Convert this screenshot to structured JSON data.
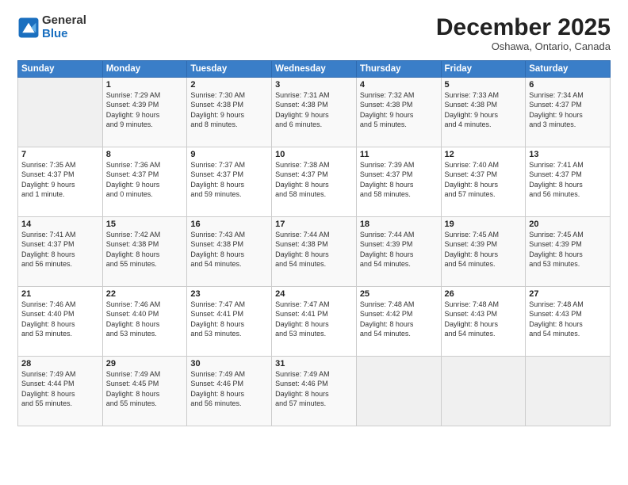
{
  "logo": {
    "general": "General",
    "blue": "Blue"
  },
  "title": "December 2025",
  "location": "Oshawa, Ontario, Canada",
  "days_header": [
    "Sunday",
    "Monday",
    "Tuesday",
    "Wednesday",
    "Thursday",
    "Friday",
    "Saturday"
  ],
  "weeks": [
    [
      {
        "num": "",
        "info": ""
      },
      {
        "num": "1",
        "info": "Sunrise: 7:29 AM\nSunset: 4:39 PM\nDaylight: 9 hours\nand 9 minutes."
      },
      {
        "num": "2",
        "info": "Sunrise: 7:30 AM\nSunset: 4:38 PM\nDaylight: 9 hours\nand 8 minutes."
      },
      {
        "num": "3",
        "info": "Sunrise: 7:31 AM\nSunset: 4:38 PM\nDaylight: 9 hours\nand 6 minutes."
      },
      {
        "num": "4",
        "info": "Sunrise: 7:32 AM\nSunset: 4:38 PM\nDaylight: 9 hours\nand 5 minutes."
      },
      {
        "num": "5",
        "info": "Sunrise: 7:33 AM\nSunset: 4:38 PM\nDaylight: 9 hours\nand 4 minutes."
      },
      {
        "num": "6",
        "info": "Sunrise: 7:34 AM\nSunset: 4:37 PM\nDaylight: 9 hours\nand 3 minutes."
      }
    ],
    [
      {
        "num": "7",
        "info": "Sunrise: 7:35 AM\nSunset: 4:37 PM\nDaylight: 9 hours\nand 1 minute."
      },
      {
        "num": "8",
        "info": "Sunrise: 7:36 AM\nSunset: 4:37 PM\nDaylight: 9 hours\nand 0 minutes."
      },
      {
        "num": "9",
        "info": "Sunrise: 7:37 AM\nSunset: 4:37 PM\nDaylight: 8 hours\nand 59 minutes."
      },
      {
        "num": "10",
        "info": "Sunrise: 7:38 AM\nSunset: 4:37 PM\nDaylight: 8 hours\nand 58 minutes."
      },
      {
        "num": "11",
        "info": "Sunrise: 7:39 AM\nSunset: 4:37 PM\nDaylight: 8 hours\nand 58 minutes."
      },
      {
        "num": "12",
        "info": "Sunrise: 7:40 AM\nSunset: 4:37 PM\nDaylight: 8 hours\nand 57 minutes."
      },
      {
        "num": "13",
        "info": "Sunrise: 7:41 AM\nSunset: 4:37 PM\nDaylight: 8 hours\nand 56 minutes."
      }
    ],
    [
      {
        "num": "14",
        "info": "Sunrise: 7:41 AM\nSunset: 4:37 PM\nDaylight: 8 hours\nand 56 minutes."
      },
      {
        "num": "15",
        "info": "Sunrise: 7:42 AM\nSunset: 4:38 PM\nDaylight: 8 hours\nand 55 minutes."
      },
      {
        "num": "16",
        "info": "Sunrise: 7:43 AM\nSunset: 4:38 PM\nDaylight: 8 hours\nand 54 minutes."
      },
      {
        "num": "17",
        "info": "Sunrise: 7:44 AM\nSunset: 4:38 PM\nDaylight: 8 hours\nand 54 minutes."
      },
      {
        "num": "18",
        "info": "Sunrise: 7:44 AM\nSunset: 4:39 PM\nDaylight: 8 hours\nand 54 minutes."
      },
      {
        "num": "19",
        "info": "Sunrise: 7:45 AM\nSunset: 4:39 PM\nDaylight: 8 hours\nand 54 minutes."
      },
      {
        "num": "20",
        "info": "Sunrise: 7:45 AM\nSunset: 4:39 PM\nDaylight: 8 hours\nand 53 minutes."
      }
    ],
    [
      {
        "num": "21",
        "info": "Sunrise: 7:46 AM\nSunset: 4:40 PM\nDaylight: 8 hours\nand 53 minutes."
      },
      {
        "num": "22",
        "info": "Sunrise: 7:46 AM\nSunset: 4:40 PM\nDaylight: 8 hours\nand 53 minutes."
      },
      {
        "num": "23",
        "info": "Sunrise: 7:47 AM\nSunset: 4:41 PM\nDaylight: 8 hours\nand 53 minutes."
      },
      {
        "num": "24",
        "info": "Sunrise: 7:47 AM\nSunset: 4:41 PM\nDaylight: 8 hours\nand 53 minutes."
      },
      {
        "num": "25",
        "info": "Sunrise: 7:48 AM\nSunset: 4:42 PM\nDaylight: 8 hours\nand 54 minutes."
      },
      {
        "num": "26",
        "info": "Sunrise: 7:48 AM\nSunset: 4:43 PM\nDaylight: 8 hours\nand 54 minutes."
      },
      {
        "num": "27",
        "info": "Sunrise: 7:48 AM\nSunset: 4:43 PM\nDaylight: 8 hours\nand 54 minutes."
      }
    ],
    [
      {
        "num": "28",
        "info": "Sunrise: 7:49 AM\nSunset: 4:44 PM\nDaylight: 8 hours\nand 55 minutes."
      },
      {
        "num": "29",
        "info": "Sunrise: 7:49 AM\nSunset: 4:45 PM\nDaylight: 8 hours\nand 55 minutes."
      },
      {
        "num": "30",
        "info": "Sunrise: 7:49 AM\nSunset: 4:46 PM\nDaylight: 8 hours\nand 56 minutes."
      },
      {
        "num": "31",
        "info": "Sunrise: 7:49 AM\nSunset: 4:46 PM\nDaylight: 8 hours\nand 57 minutes."
      },
      {
        "num": "",
        "info": ""
      },
      {
        "num": "",
        "info": ""
      },
      {
        "num": "",
        "info": ""
      }
    ]
  ]
}
